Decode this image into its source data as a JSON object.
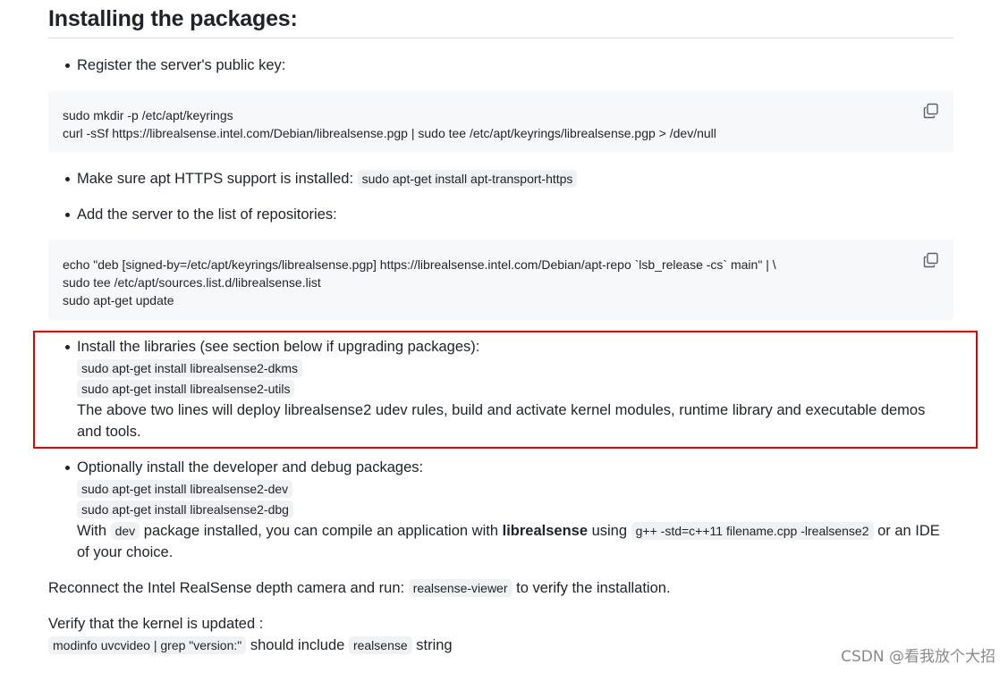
{
  "heading": "Installing the packages:",
  "step1": {
    "text": "Register the server's public key:",
    "code": [
      "sudo mkdir -p /etc/apt/keyrings",
      "curl -sSf https://librealsense.intel.com/Debian/librealsense.pgp | sudo tee /etc/apt/keyrings/librealsense.pgp > /dev/null"
    ]
  },
  "step2": {
    "text": "Make sure apt HTTPS support is installed:",
    "code": "sudo apt-get install apt-transport-https"
  },
  "step3": {
    "text": "Add the server to the list of repositories:",
    "code": [
      "echo \"deb [signed-by=/etc/apt/keyrings/librealsense.pgp] https://librealsense.intel.com/Debian/apt-repo `lsb_release -cs` main\" | \\",
      "sudo tee /etc/apt/sources.list.d/librealsense.list",
      "sudo apt-get update"
    ]
  },
  "step4": {
    "text": "Install the libraries (see section below if upgrading packages):",
    "code1": "sudo apt-get install librealsense2-dkms",
    "code2": "sudo apt-get install librealsense2-utils",
    "note": "The above two lines will deploy librealsense2 udev rules, build and activate kernel modules, runtime library and executable demos and tools."
  },
  "step5": {
    "text": "Optionally install the developer and debug packages:",
    "code1": "sudo apt-get install librealsense2-dev",
    "code2": "sudo apt-get install librealsense2-dbg",
    "with": "With",
    "dev": "dev",
    "mid": "package installed, you can compile an application with",
    "lib": "librealsense",
    "using": "using",
    "compile": "g++ -std=c++11 filename.cpp -lrealsense2",
    "end": "or an IDE of your choice."
  },
  "reconnect": {
    "text": "Reconnect the Intel RealSense depth camera and run:",
    "code": "realsense-viewer",
    "after": "to verify the installation."
  },
  "verify": {
    "text": "Verify that the kernel is updated :",
    "code": "modinfo uvcvideo | grep \"version:\"",
    "mid": "should include",
    "code2": "realsense",
    "after": "string"
  },
  "watermark": "CSDN @看我放个大招",
  "icons": {
    "copy": "copy-icon"
  },
  "colors": {
    "highlight_border": "#e00000",
    "code_bg": "#f6f8fa"
  }
}
